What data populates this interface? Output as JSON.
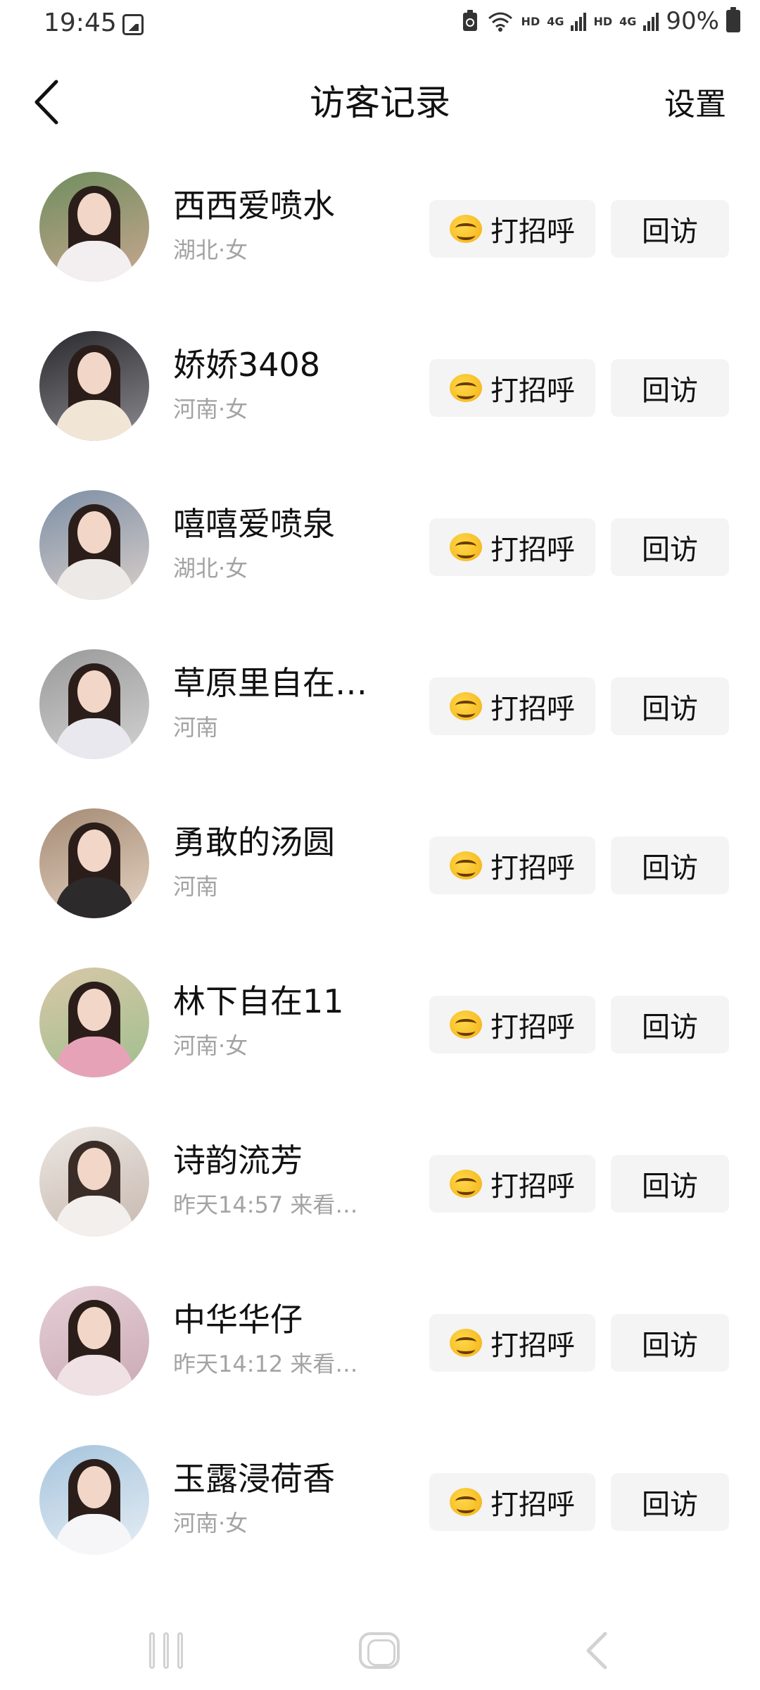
{
  "status_bar": {
    "time": "19:45",
    "hd1": "HD",
    "net1": "4G",
    "hd2": "HD",
    "net2": "4G",
    "battery": "90%"
  },
  "header": {
    "title": "访客记录",
    "settings": "设置"
  },
  "actions": {
    "greet": "打招呼",
    "revisit": "回访"
  },
  "visitors": [
    {
      "name": "西西爱喷水",
      "sub": "湖北·女"
    },
    {
      "name": "娇娇3408",
      "sub": "河南·女"
    },
    {
      "name": "嘻嘻爱喷泉",
      "sub": "湖北·女"
    },
    {
      "name": "草原里自在…",
      "sub": "河南"
    },
    {
      "name": "勇敢的汤圆",
      "sub": "河南"
    },
    {
      "name": "林下自在11",
      "sub": "河南·女"
    },
    {
      "name": "诗韵流芳",
      "sub": "昨天14:57 来看…"
    },
    {
      "name": "中华华仔",
      "sub": "昨天14:12 来看…"
    },
    {
      "name": "玉露浸荷香",
      "sub": "河南·女"
    }
  ]
}
